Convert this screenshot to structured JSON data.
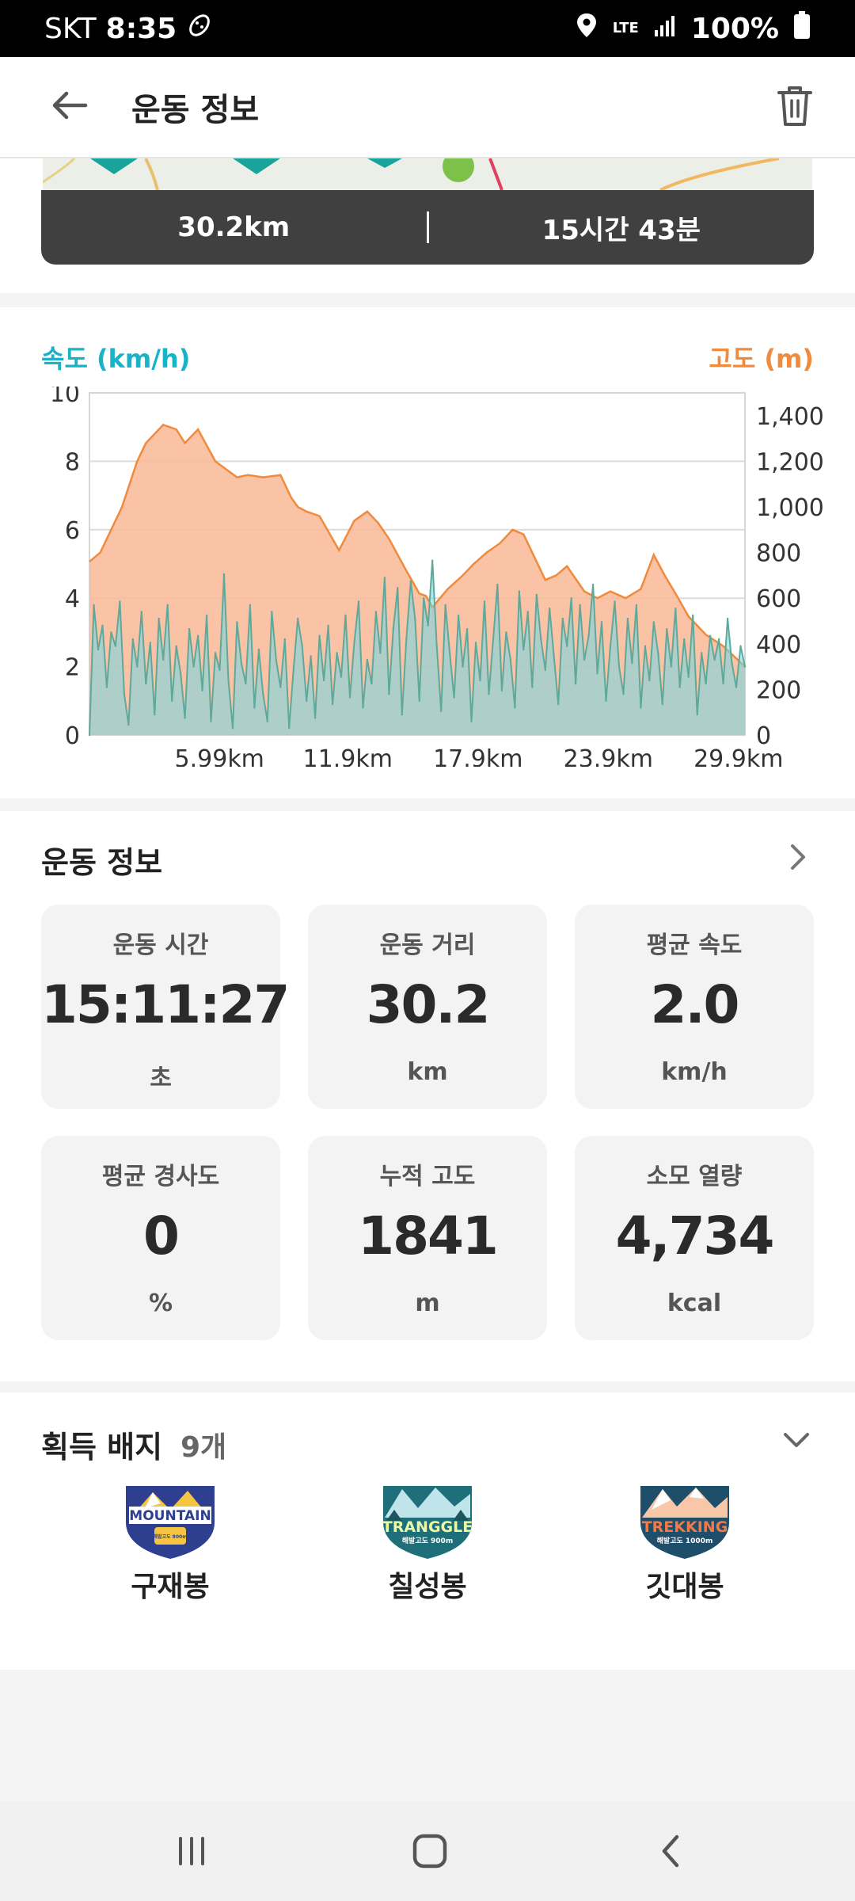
{
  "status_bar": {
    "carrier": "SKT",
    "time": "8:35",
    "network": "LTE",
    "battery": "100%"
  },
  "app_bar": {
    "title": "운동 정보"
  },
  "summary": {
    "distance": "30.2km",
    "duration": "15시간 43분"
  },
  "chart_data": {
    "type": "area",
    "left_axis_label": "속도 (km/h)",
    "right_axis_label": "고도 (m)",
    "left_ylim": [
      0,
      10
    ],
    "left_ticks": [
      "10",
      "8",
      "6",
      "4",
      "2",
      "0"
    ],
    "right_ylim": [
      0,
      1500
    ],
    "right_ticks": [
      "1,400",
      "1,200",
      "1,000",
      "800",
      "600",
      "400",
      "200",
      "0"
    ],
    "x_ticks": [
      "5.99km",
      "11.9km",
      "17.9km",
      "23.9km",
      "29.9km"
    ],
    "xlim": [
      0,
      30.2
    ],
    "grid": true,
    "series": [
      {
        "name": "고도 (m)",
        "color": "#f5a57c",
        "x": [
          0,
          0.5,
          1.5,
          2.2,
          2.6,
          3.4,
          4.0,
          4.4,
          5.0,
          5.8,
          6.8,
          7.3,
          8.0,
          8.8,
          9.3,
          9.6,
          10.0,
          10.6,
          11.5,
          12.2,
          12.8,
          13.3,
          13.8,
          14.6,
          15.2,
          15.5,
          15.8,
          16.5,
          17.2,
          17.7,
          18.3,
          18.9,
          19.5,
          20.0,
          20.5,
          21.0,
          21.5,
          22.0,
          22.8,
          23.4,
          24.0,
          24.7,
          25.4,
          26.0,
          26.5,
          27.0,
          27.6,
          28.4,
          29.2,
          30.2
        ],
        "values": [
          760,
          800,
          1000,
          1200,
          1280,
          1360,
          1340,
          1280,
          1340,
          1200,
          1130,
          1140,
          1130,
          1140,
          1040,
          1000,
          980,
          960,
          810,
          940,
          980,
          930,
          860,
          720,
          620,
          610,
          560,
          640,
          700,
          750,
          800,
          840,
          900,
          880,
          780,
          680,
          700,
          740,
          630,
          600,
          630,
          600,
          640,
          790,
          700,
          620,
          520,
          440,
          390,
          300
        ]
      },
      {
        "name": "속도 (km/h)",
        "color": "#5fa89a",
        "x": [
          0,
          0.2,
          0.4,
          0.6,
          0.8,
          1.0,
          1.2,
          1.4,
          1.6,
          1.8,
          2.0,
          2.2,
          2.4,
          2.6,
          2.8,
          3.0,
          3.2,
          3.4,
          3.6,
          3.8,
          4.0,
          4.2,
          4.4,
          4.6,
          4.8,
          5.0,
          5.2,
          5.4,
          5.6,
          5.8,
          6.0,
          6.2,
          6.4,
          6.6,
          6.8,
          7.0,
          7.2,
          7.4,
          7.6,
          7.8,
          8.0,
          8.2,
          8.4,
          8.6,
          8.8,
          9.0,
          9.2,
          9.4,
          9.6,
          9.8,
          10.0,
          10.2,
          10.4,
          10.6,
          10.8,
          11.0,
          11.2,
          11.4,
          11.6,
          11.8,
          12.0,
          12.2,
          12.4,
          12.6,
          12.8,
          13.0,
          13.2,
          13.4,
          13.6,
          13.8,
          14.0,
          14.2,
          14.4,
          14.6,
          14.8,
          15.0,
          15.2,
          15.4,
          15.6,
          15.8,
          16.0,
          16.2,
          16.4,
          16.6,
          16.8,
          17.0,
          17.2,
          17.4,
          17.6,
          17.8,
          18.0,
          18.2,
          18.4,
          18.6,
          18.8,
          19.0,
          19.2,
          19.4,
          19.6,
          19.8,
          20.0,
          20.2,
          20.4,
          20.6,
          20.8,
          21.0,
          21.2,
          21.4,
          21.6,
          21.8,
          22.0,
          22.2,
          22.4,
          22.6,
          22.8,
          23.0,
          23.2,
          23.4,
          23.6,
          23.8,
          24.0,
          24.2,
          24.4,
          24.6,
          24.8,
          25.0,
          25.2,
          25.4,
          25.6,
          25.8,
          26.0,
          26.2,
          26.4,
          26.6,
          26.8,
          27.0,
          27.2,
          27.4,
          27.6,
          27.8,
          28.0,
          28.2,
          28.4,
          28.6,
          28.8,
          29.0,
          29.2,
          29.4,
          29.6,
          29.8,
          30.0,
          30.2
        ],
        "values": [
          0,
          3.8,
          2.5,
          3.2,
          1.4,
          3.0,
          2.6,
          3.9,
          1.2,
          0.3,
          2.8,
          2.0,
          3.6,
          1.5,
          2.7,
          0.6,
          3.4,
          2.2,
          3.8,
          1.0,
          2.6,
          1.8,
          0.5,
          3.1,
          2.0,
          2.9,
          1.3,
          3.5,
          0.4,
          2.4,
          1.9,
          4.7,
          1.6,
          0.2,
          3.3,
          2.1,
          1.5,
          3.8,
          0.8,
          2.5,
          1.2,
          0.4,
          3.6,
          2.2,
          1.4,
          2.8,
          0.2,
          1.9,
          3.4,
          2.6,
          1.0,
          2.3,
          0.5,
          2.9,
          1.6,
          3.2,
          0.9,
          2.4,
          1.7,
          3.5,
          1.1,
          2.7,
          3.9,
          0.8,
          2.2,
          1.5,
          3.6,
          2.4,
          4.6,
          1.2,
          3.1,
          4.3,
          0.6,
          2.8,
          4.5,
          3.4,
          1.0,
          4.0,
          3.2,
          5.1,
          2.6,
          0.7,
          3.8,
          2.4,
          1.1,
          3.5,
          2.0,
          3.1,
          0.4,
          2.7,
          1.6,
          3.9,
          1.2,
          2.8,
          4.4,
          1.3,
          3.0,
          2.2,
          0.8,
          4.2,
          2.5,
          3.6,
          1.4,
          4.1,
          2.8,
          1.9,
          3.7,
          2.3,
          0.9,
          3.4,
          2.6,
          4.0,
          1.5,
          3.8,
          2.2,
          2.9,
          4.4,
          1.8,
          3.3,
          1.0,
          2.6,
          3.9,
          2.0,
          1.2,
          3.4,
          2.1,
          3.8,
          0.8,
          2.6,
          1.6,
          3.3,
          2.4,
          0.9,
          3.1,
          2.0,
          3.7,
          1.4,
          2.8,
          1.7,
          3.5,
          0.6,
          2.4,
          1.5,
          2.9,
          2.2,
          2.8,
          1.5,
          3.4,
          2.1,
          1.4,
          2.6,
          2.0
        ]
      }
    ]
  },
  "info": {
    "title": "운동 정보",
    "cards": [
      {
        "label": "운동 시간",
        "value": "15:11:27",
        "unit": "초"
      },
      {
        "label": "운동 거리",
        "value": "30.2",
        "unit": "km"
      },
      {
        "label": "평균 속도",
        "value": "2.0",
        "unit": "km/h"
      },
      {
        "label": "평균 경사도",
        "value": "0",
        "unit": "%"
      },
      {
        "label": "누적 고도",
        "value": "1841",
        "unit": "m"
      },
      {
        "label": "소모 열량",
        "value": "4,734",
        "unit": "kcal"
      }
    ]
  },
  "badges": {
    "title": "획득 배지",
    "count": "9개",
    "items": [
      {
        "name": "구재봉",
        "badge_text": "MOUNTAIN",
        "badge_sub": "해발고도 800m",
        "color": "#2e3f8f"
      },
      {
        "name": "칠성봉",
        "badge_text": "TRANGGLE",
        "badge_sub": "해발고도 900m",
        "color": "#1f6f7a"
      },
      {
        "name": "깃대봉",
        "badge_text": "TREKKING",
        "badge_sub": "해발고도 1000m",
        "color": "#1f4e6b"
      }
    ]
  }
}
